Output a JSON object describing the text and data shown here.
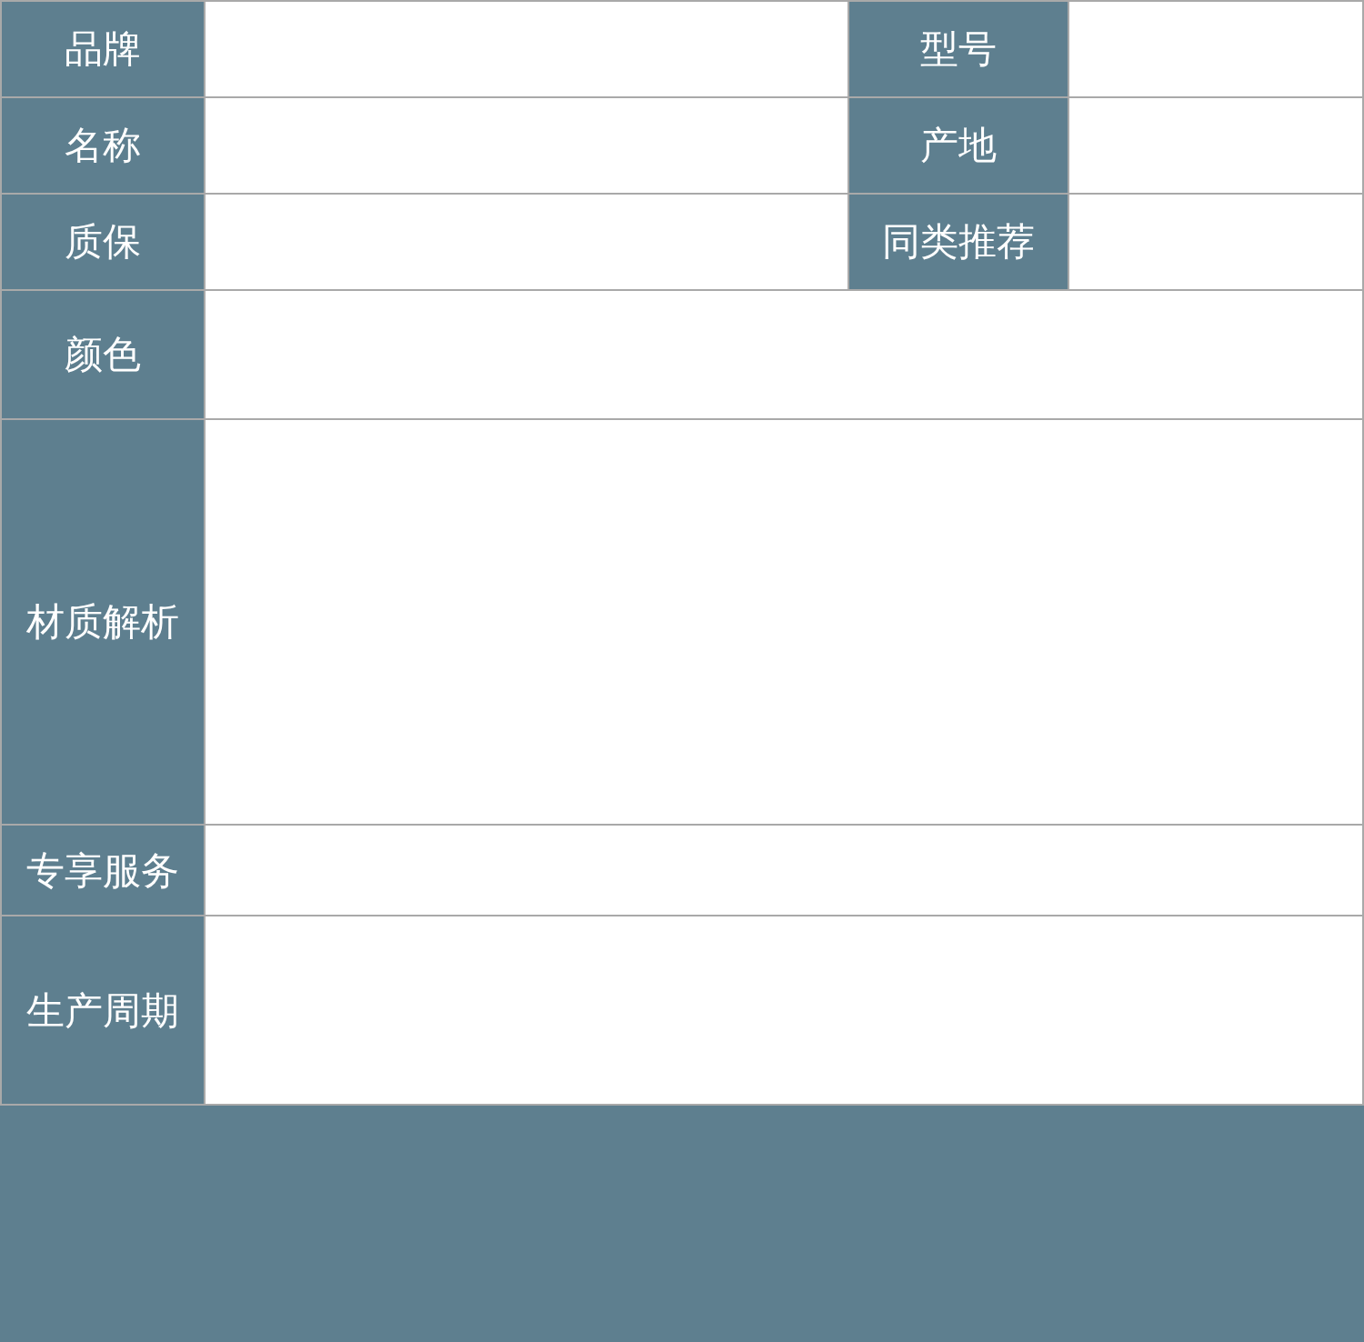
{
  "rows": [
    {
      "label": "品牌",
      "side_label": "型号"
    },
    {
      "label": "名称",
      "side_label": "产地"
    },
    {
      "label": "质保",
      "side_label": "同类推荐"
    },
    {
      "label": "颜色"
    },
    {
      "label": "材质解析"
    },
    {
      "label": "专享服务"
    },
    {
      "label": "生产周期"
    }
  ]
}
